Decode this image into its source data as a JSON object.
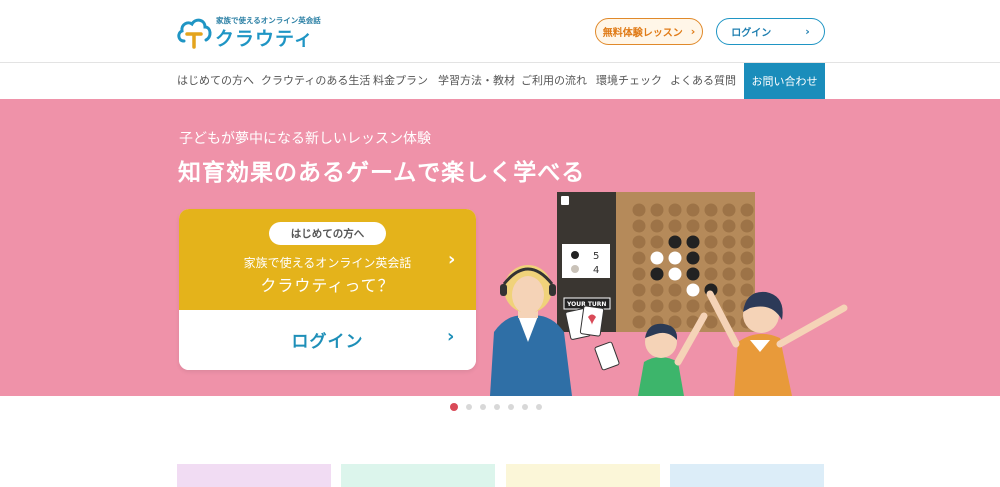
{
  "header": {
    "logo_tagline": "家族で使えるオンライン英会話",
    "logo_name": "クラウティ",
    "trial_button": "無料体験レッスン",
    "login_button": "ログイン"
  },
  "nav": {
    "items": [
      "はじめての方へ",
      "クラウティのある生活",
      "料金プラン",
      "学習方法・教材",
      "ご利用の流れ",
      "環境チェック",
      "よくある質問"
    ],
    "contact": "お問い合わせ"
  },
  "hero": {
    "subtitle": "子どもが夢中になる新しいレッスン体験",
    "title": "知育効果のあるゲームで楽しく学べる",
    "card": {
      "pill": "はじめての方へ",
      "line1": "家族で使えるオンライン英会話",
      "line2": "クラウティって？",
      "login": "ログイン"
    },
    "game": {
      "score_black": "5",
      "score_white": "4",
      "turn_label": "YOUR TURN"
    }
  },
  "carousel": {
    "slide_count": 7,
    "active_index": 0
  },
  "colors": {
    "hero_bg": "#ef92a9",
    "card_yellow": "#e4b31b",
    "accent_blue": "#1a8dbb",
    "trial_orange": "#e07b17",
    "tile_colors": [
      "#f1dcf3",
      "#dcf5ec",
      "#fbf6d8",
      "#dcedf8"
    ]
  }
}
